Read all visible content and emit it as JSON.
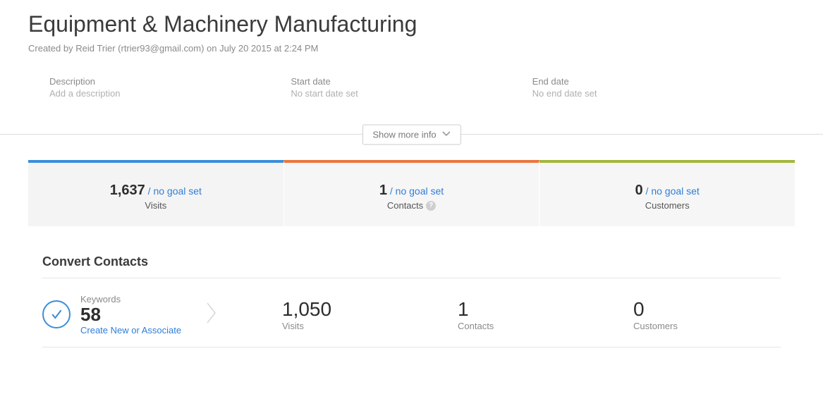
{
  "header": {
    "title": "Equipment & Machinery Manufacturing",
    "created_by": "Created by Reid Trier (rtrier93@gmail.com) on July 20 2015 at 2:24 PM"
  },
  "meta": {
    "description_label": "Description",
    "description_value": "Add a description",
    "start_label": "Start date",
    "start_value": "No start date set",
    "end_label": "End date",
    "end_value": "No end date set"
  },
  "show_more_label": "Show more info",
  "tabs": {
    "visits": {
      "value": "1,637",
      "goal": " / no goal set",
      "label": "Visits"
    },
    "contacts": {
      "value": "1",
      "goal": " / no goal set",
      "label": "Contacts"
    },
    "customers": {
      "value": "0",
      "goal": " / no goal set",
      "label": "Customers"
    }
  },
  "section_title": "Convert Contacts",
  "row": {
    "keywords_label": "Keywords",
    "keywords_value": "58",
    "create_link": "Create New or Associate",
    "visits_value": "1,050",
    "visits_label": "Visits",
    "contacts_value": "1",
    "contacts_label": "Contacts",
    "customers_value": "0",
    "customers_label": "Customers"
  }
}
